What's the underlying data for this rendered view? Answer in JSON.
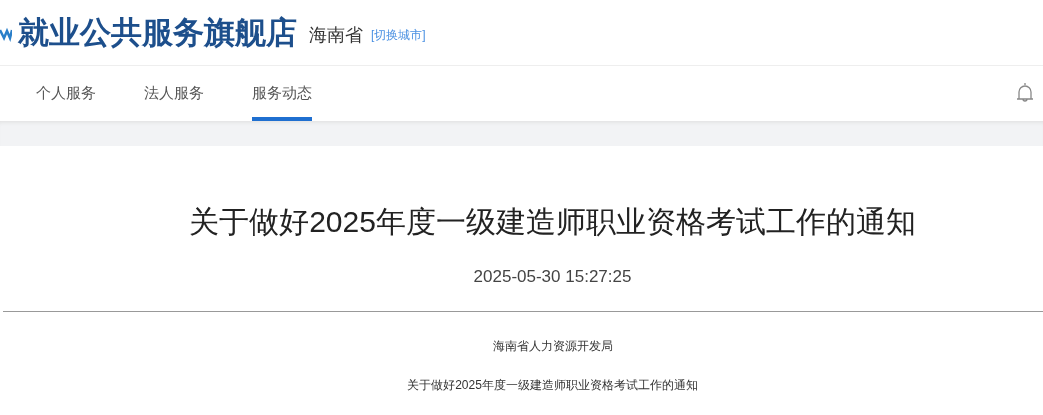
{
  "header": {
    "site_title": "就业公共服务旗舰店",
    "province": "海南省",
    "switch_city": "[切换城市]"
  },
  "tabs": [
    {
      "label": "个人服务",
      "selected": false
    },
    {
      "label": "法人服务",
      "selected": false
    },
    {
      "label": "服务动态",
      "selected": true
    }
  ],
  "article": {
    "title": "关于做好2025年度一级建造师职业资格考试工作的通知",
    "date": "2025-05-30 15:27:25",
    "paragraphs": [
      "海南省人力资源开发局",
      "关于做好2025年度一级建造师职业资格考试工作的通知"
    ]
  }
}
